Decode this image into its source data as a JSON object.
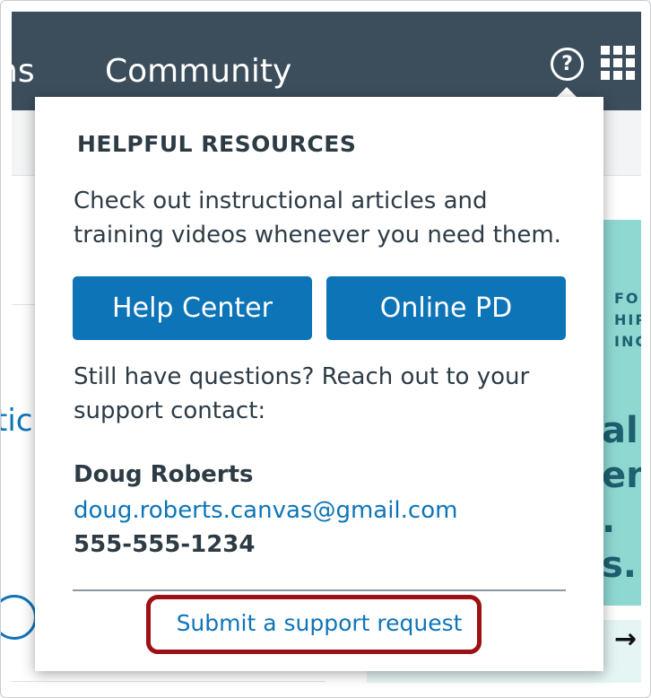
{
  "nav": {
    "partial_item": "ns",
    "community_label": "Community",
    "help_icon": "?",
    "apps_icon_name": "grid-9-icon"
  },
  "background": {
    "left_partial_link": "tic",
    "promo_small_lines": [
      "FOR",
      "HIP",
      "ING"
    ],
    "promo_big_lines": [
      "al",
      "ent",
      ".",
      "s."
    ],
    "arrow_icon": "→"
  },
  "popover": {
    "heading": "HELPFUL RESOURCES",
    "intro": "Check out instructional articles and training videos whenever you need them.",
    "help_center_label": "Help Center",
    "online_pd_label": "Online PD",
    "still_text": "Still have questions? Reach out to your support contact:",
    "contact": {
      "name": "Doug Roberts",
      "email": "doug.roberts.canvas@gmail.com",
      "phone": "555-555-1234"
    },
    "support_link": "Submit a support request"
  },
  "colors": {
    "nav_bg": "#3c4e5c",
    "primary": "#0e74b8",
    "text": "#2d3b45",
    "highlight": "#9c1016",
    "promo": "#8fd8d2"
  }
}
